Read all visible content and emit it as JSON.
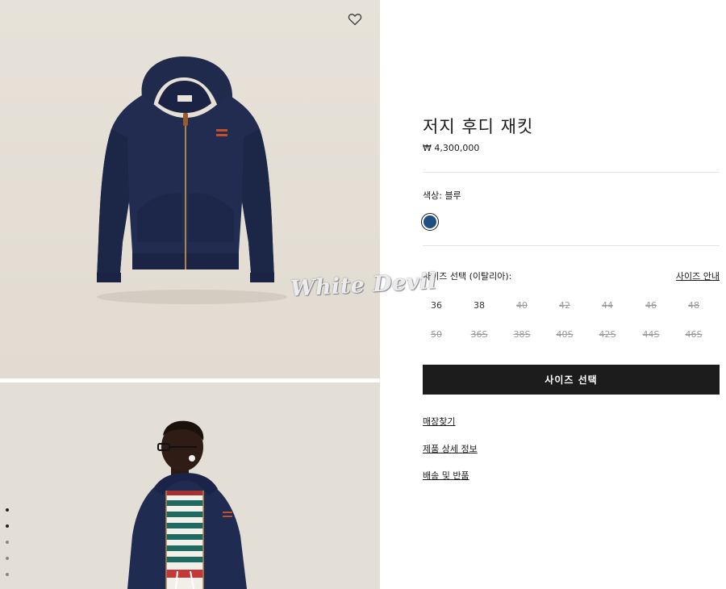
{
  "product": {
    "title": "저지 후디 재킷",
    "price": "₩ 4,300,000"
  },
  "color": {
    "label": "색상:  블루",
    "swatch": "#1d4f80"
  },
  "size": {
    "label": "사이즈 선택 (이탈리아):",
    "guide_link": "사이즈 안내",
    "rows": [
      [
        {
          "label": "36",
          "available": true
        },
        {
          "label": "38",
          "available": true
        },
        {
          "label": "40",
          "available": false
        },
        {
          "label": "42",
          "available": false
        },
        {
          "label": "44",
          "available": false
        },
        {
          "label": "46",
          "available": false
        },
        {
          "label": "48",
          "available": false
        }
      ],
      [
        {
          "label": "50",
          "available": false
        },
        {
          "label": "36S",
          "available": false
        },
        {
          "label": "38S",
          "available": false
        },
        {
          "label": "40S",
          "available": false
        },
        {
          "label": "42S",
          "available": false
        },
        {
          "label": "44S",
          "available": false
        },
        {
          "label": "46S",
          "available": false
        }
      ]
    ],
    "button_label": "사이즈 선택"
  },
  "links": {
    "store_locator": "매장찾기",
    "product_details": "제품 상세 정보",
    "shipping_returns": "배송 및 반품"
  },
  "gallery": {
    "watermark": "White Devil",
    "wishlist_icon": "heart-outline-icon",
    "dots": [
      true,
      true,
      false,
      false,
      false
    ]
  },
  "colors": {
    "navy": "#1f2a4d",
    "bg_photo": "#e6e1d8",
    "button": "#1c1c1c"
  }
}
